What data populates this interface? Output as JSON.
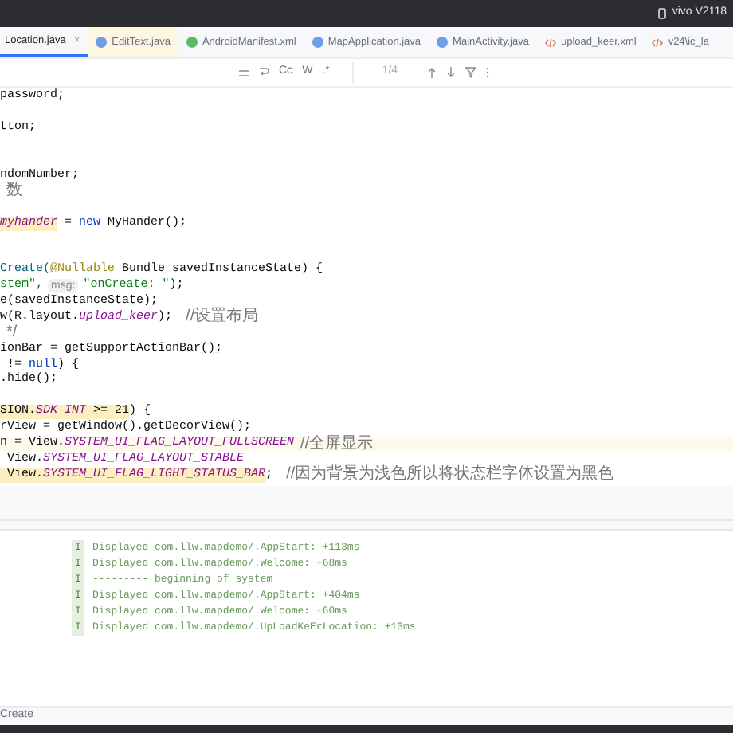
{
  "title_bar": {
    "device": "vivo V2118"
  },
  "tabs": [
    {
      "label": "Location.java",
      "selected": true,
      "modified": false,
      "close": "×"
    },
    {
      "label": "EditText.java",
      "kind": "java",
      "selected": false,
      "modified": true
    },
    {
      "label": "AndroidManifest.xml",
      "kind": "manifest",
      "selected": false,
      "modified": false
    },
    {
      "label": "MapApplication.java",
      "kind": "java",
      "selected": false,
      "modified": false
    },
    {
      "label": "MainActivity.java",
      "kind": "java",
      "selected": false,
      "modified": false
    },
    {
      "label": "upload_keer.xml",
      "kind": "xml",
      "selected": false,
      "modified": false
    },
    {
      "label": "v24\\ic_la",
      "kind": "xml",
      "selected": false,
      "modified": false
    }
  ],
  "find_bar": {
    "case_toggle": "Cc",
    "word_toggle": "W",
    "regex_toggle": ".*",
    "match_count": "1/4"
  },
  "code_lines": [
    {
      "kind": "code",
      "current": false,
      "segments": [
        {
          "kind": "plain",
          "text": "password;"
        }
      ]
    },
    {
      "kind": "blank"
    },
    {
      "kind": "code",
      "current": false,
      "segments": [
        {
          "kind": "plain",
          "text": "tton;"
        }
      ]
    },
    {
      "kind": "blank"
    },
    {
      "kind": "blank"
    },
    {
      "kind": "code",
      "current": false,
      "segments": [
        {
          "kind": "plain",
          "text": "ndomNumber;"
        }
      ]
    },
    {
      "kind": "code",
      "current": false,
      "segments": [
        {
          "kind": "comment",
          "text": "数"
        }
      ]
    },
    {
      "kind": "blank"
    },
    {
      "kind": "code",
      "current": false,
      "segments": [
        {
          "kind": "field",
          "text": "myhander",
          "highlight": true
        },
        {
          "kind": "plain",
          "text": " = "
        },
        {
          "kind": "keyword",
          "text": "new"
        },
        {
          "kind": "plain",
          "text": " MyHander();"
        }
      ]
    },
    {
      "kind": "blank"
    },
    {
      "kind": "blank"
    },
    {
      "kind": "code",
      "current": false,
      "segments": [
        {
          "kind": "method",
          "text": "Create("
        },
        {
          "kind": "annotation",
          "text": "@Nullable"
        },
        {
          "kind": "plain",
          "text": " Bundle savedInstanceState) {"
        }
      ]
    },
    {
      "kind": "code",
      "current": false,
      "segments": [
        {
          "kind": "string",
          "text": "stem\","
        },
        {
          "kind": "hint",
          "text": "msg:"
        },
        {
          "kind": "string",
          "text": "\"onCreate: \""
        },
        {
          "kind": "plain",
          "text": ");"
        }
      ]
    },
    {
      "kind": "code",
      "current": false,
      "segments": [
        {
          "kind": "plain",
          "text": "e(savedInstanceState);"
        }
      ]
    },
    {
      "kind": "code",
      "current": false,
      "segments": [
        {
          "kind": "plain",
          "text": "w(R.layout."
        },
        {
          "kind": "field",
          "text": "upload_keer"
        },
        {
          "kind": "plain",
          "text": "); "
        },
        {
          "kind": "comment",
          "text": "//设置布局"
        }
      ]
    },
    {
      "kind": "code",
      "current": false,
      "segments": [
        {
          "kind": "comment",
          "text": "*/"
        }
      ]
    },
    {
      "kind": "code",
      "current": false,
      "segments": [
        {
          "kind": "plain",
          "text": "ionBar = getSupportActionBar();"
        }
      ]
    },
    {
      "kind": "code",
      "current": false,
      "segments": [
        {
          "kind": "plain",
          "text": " != "
        },
        {
          "kind": "keyword",
          "text": "null"
        },
        {
          "kind": "plain",
          "text": ") {"
        }
      ]
    },
    {
      "kind": "code",
      "current": false,
      "segments": [
        {
          "kind": "plain",
          "text": ".hide();"
        }
      ]
    },
    {
      "kind": "blank"
    },
    {
      "kind": "code",
      "current": false,
      "segments": [
        {
          "kind": "plain",
          "text": "SION.",
          "highlight": true
        },
        {
          "kind": "field",
          "text": "SDK_INT",
          "highlight": true
        },
        {
          "kind": "plain",
          "text": " >= 21",
          "highlight": true
        },
        {
          "kind": "plain",
          "text": ") {"
        }
      ]
    },
    {
      "kind": "code",
      "current": false,
      "segments": [
        {
          "kind": "plain",
          "text": "rView = getWindow().getDecorView();"
        }
      ]
    },
    {
      "kind": "code",
      "current": true,
      "segments": [
        {
          "kind": "plain",
          "text": "n = View."
        },
        {
          "kind": "field",
          "text": "SYSTEM_UI_FLAG_LAYOUT_FULLSCREEN"
        },
        {
          "kind": "comment",
          "text": "//全屏显示"
        }
      ]
    },
    {
      "kind": "code",
      "current": false,
      "segments": [
        {
          "kind": "plain",
          "text": " View."
        },
        {
          "kind": "field",
          "text": "SYSTEM_UI_FLAG_LAYOUT_STABLE"
        }
      ]
    },
    {
      "kind": "code",
      "current": false,
      "segments": [
        {
          "kind": "plain",
          "text": " View.",
          "highlight": true
        },
        {
          "kind": "field",
          "text": "SYSTEM_UI_FLAG_LIGHT_STATUS_BAR",
          "highlight": true
        },
        {
          "kind": "plain",
          "text": "; "
        },
        {
          "kind": "comment",
          "text": "//因为背景为浅色所以将状态栏字体设置为黑色"
        }
      ]
    }
  ],
  "log": [
    {
      "level": "I",
      "text": "Displayed com.llw.mapdemo/.AppStart: +113ms"
    },
    {
      "level": "I",
      "text": "Displayed com.llw.mapdemo/.Welcome: +68ms"
    },
    {
      "level": "I",
      "text": "--------- beginning of system"
    },
    {
      "level": "I",
      "text": "Displayed com.llw.mapdemo/.AppStart: +404ms"
    },
    {
      "level": "I",
      "text": "Displayed com.llw.mapdemo/.Welcome: +60ms"
    },
    {
      "level": "I",
      "text": "Displayed com.llw.mapdemo/.UpLoadKeErLocation: +13ms"
    }
  ],
  "status_bar": {
    "breadcrumb": "Create"
  }
}
